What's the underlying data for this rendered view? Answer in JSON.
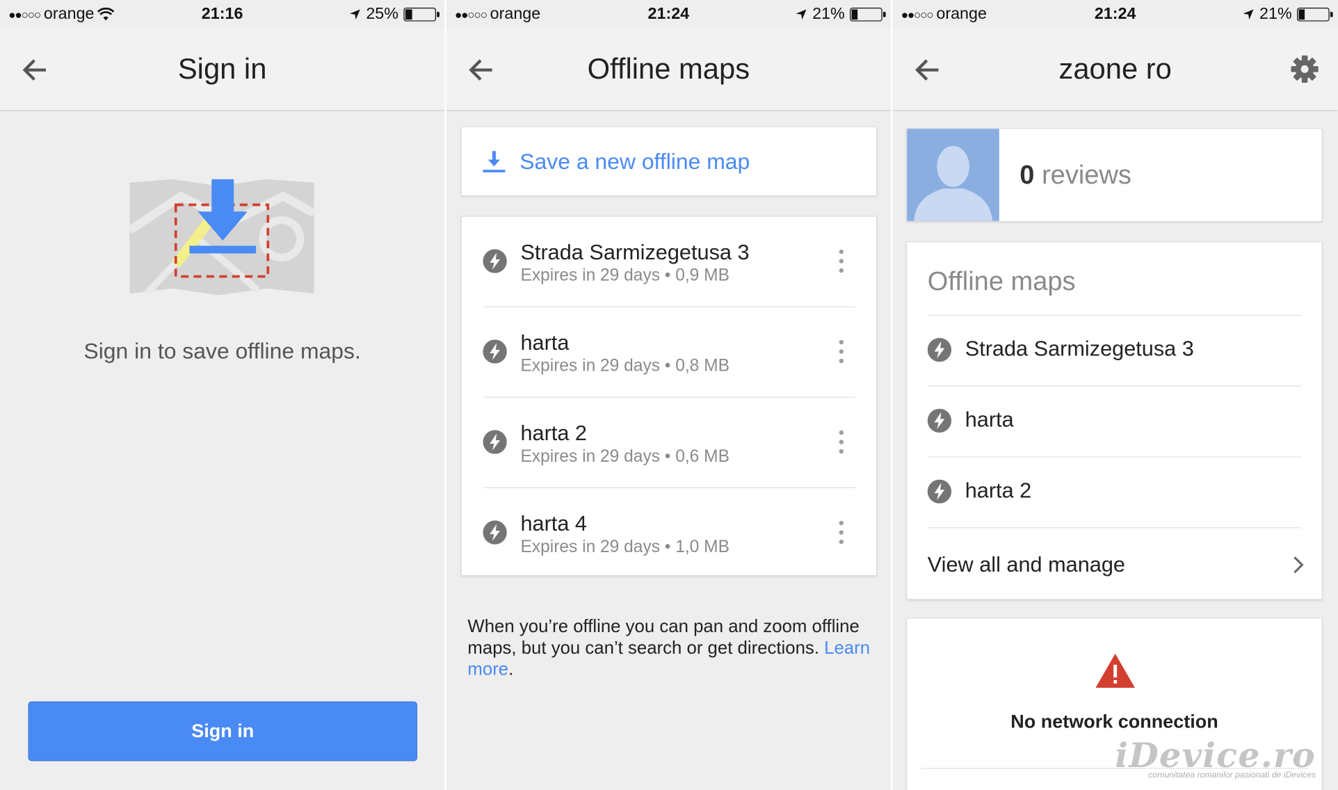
{
  "panels": [
    {
      "status": {
        "carrier": "orange",
        "time": "21:16",
        "battery": "25%",
        "battery_level": 0.25,
        "wifi": true
      },
      "header": {
        "title": "Sign in"
      },
      "message": "Sign in to save offline maps.",
      "button": "Sign in"
    },
    {
      "status": {
        "carrier": "orange",
        "time": "21:24",
        "battery": "21%",
        "battery_level": 0.21,
        "wifi": false
      },
      "header": {
        "title": "Offline maps"
      },
      "save_label": "Save a new offline map",
      "maps": [
        {
          "name": "Strada Sarmizegetusa 3",
          "meta": "Expires in 29 days • 0,9 MB"
        },
        {
          "name": "harta",
          "meta": "Expires in 29 days • 0,8 MB"
        },
        {
          "name": "harta 2",
          "meta": "Expires in 29 days • 0,6 MB"
        },
        {
          "name": "harta 4",
          "meta": "Expires in 29 days • 1,0 MB"
        }
      ],
      "info_text": "When you’re offline you can pan and zoom offline maps, but you can’t search or get directions.",
      "learn_more": "Learn more",
      "period": "."
    },
    {
      "status": {
        "carrier": "orange",
        "time": "21:24",
        "battery": "21%",
        "battery_level": 0.21,
        "wifi": false
      },
      "header": {
        "title": "zaone ro"
      },
      "reviews_count": "0",
      "reviews_label": "reviews",
      "offline_heading": "Offline maps",
      "offline_items": [
        "Strada Sarmizegetusa 3",
        "harta",
        "harta 2"
      ],
      "view_all": "View all and manage",
      "network_message": "No network connection"
    }
  ],
  "watermark": {
    "brand": "iDevice.ro",
    "tagline": "comunitatea romanilor pasionati de iDevices"
  },
  "colors": {
    "accent": "#4a8af4",
    "warning": "#d23f31",
    "avatar_bg": "#8aaee0"
  }
}
